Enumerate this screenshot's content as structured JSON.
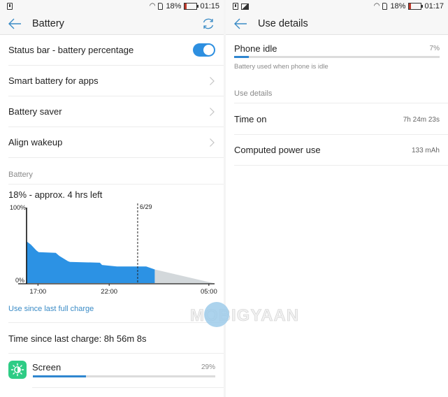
{
  "left": {
    "statusbar": {
      "battery_pct": "18%",
      "time": "01:15",
      "icons": [
        "battery-alert-icon",
        "wifi-icon",
        "sim-icon",
        "battery-icon"
      ]
    },
    "appbar": {
      "title": "Battery",
      "back_icon": "back-arrow-icon",
      "action_icon": "refresh-icon"
    },
    "settings": [
      {
        "label": "Status bar - battery percentage",
        "type": "toggle",
        "on": true
      },
      {
        "label": "Smart battery for apps",
        "type": "chevron"
      },
      {
        "label": "Battery saver",
        "type": "chevron"
      },
      {
        "label": "Align wakeup",
        "type": "chevron"
      }
    ],
    "section_header": "Battery",
    "summary": "18% - approx. 4 hrs left",
    "link": "Use since last full charge",
    "time_since": "Time since last charge: 8h 56m 8s",
    "apps": [
      {
        "name": "Screen",
        "pct_label": "29%",
        "pct": 29,
        "icon": "screen-brightness-icon",
        "icon_color": "#2ecc85"
      }
    ]
  },
  "right": {
    "statusbar": {
      "battery_pct": "18%",
      "time": "01:17",
      "icons": [
        "battery-alert-icon",
        "image-icon",
        "wifi-icon",
        "sim-icon",
        "battery-icon"
      ]
    },
    "appbar": {
      "title": "Use details",
      "back_icon": "back-arrow-icon"
    },
    "item": {
      "name": "Phone idle",
      "pct_label": "7%",
      "pct": 7,
      "description": "Battery used when phone is idle"
    },
    "section_header": "Use details",
    "details": [
      {
        "label": "Time on",
        "value": "7h 24m 23s"
      },
      {
        "label": "Computed power use",
        "value": "133 mAh"
      }
    ]
  },
  "watermark": "MOBIGYAAN",
  "colors": {
    "accent": "#2d8fe0",
    "chart_fill": "#2c92e4",
    "projection_fill": "#d3d8db",
    "link": "#3a8bc6"
  },
  "chart_data": {
    "type": "area",
    "title": "",
    "xlabel": "",
    "ylabel": "",
    "y_tick_labels": [
      "100%",
      "0%"
    ],
    "ylim": [
      0,
      100
    ],
    "x_tick_labels": [
      "17:00",
      "22:00",
      "05:00"
    ],
    "x_ticks_hours": [
      17,
      22,
      29
    ],
    "xlim_hours": [
      16.2,
      29.4
    ],
    "marker": {
      "label": "6/29",
      "x_hours": 24
    },
    "series": [
      {
        "name": "Battery level",
        "x_hours": [
          16.22,
          16.5,
          16.9,
          17.05,
          18.25,
          18.5,
          19.1,
          19.25,
          21.35,
          21.5,
          22.55,
          24.6,
          24.9,
          25.2
        ],
        "values": [
          55,
          51,
          43,
          41,
          40,
          36,
          29,
          28,
          27,
          24,
          22,
          22,
          20,
          18
        ]
      },
      {
        "name": "Projection",
        "x_hours": [
          25.2,
          29.3
        ],
        "values": [
          18,
          0
        ]
      }
    ],
    "grid": false,
    "legend": "none"
  }
}
